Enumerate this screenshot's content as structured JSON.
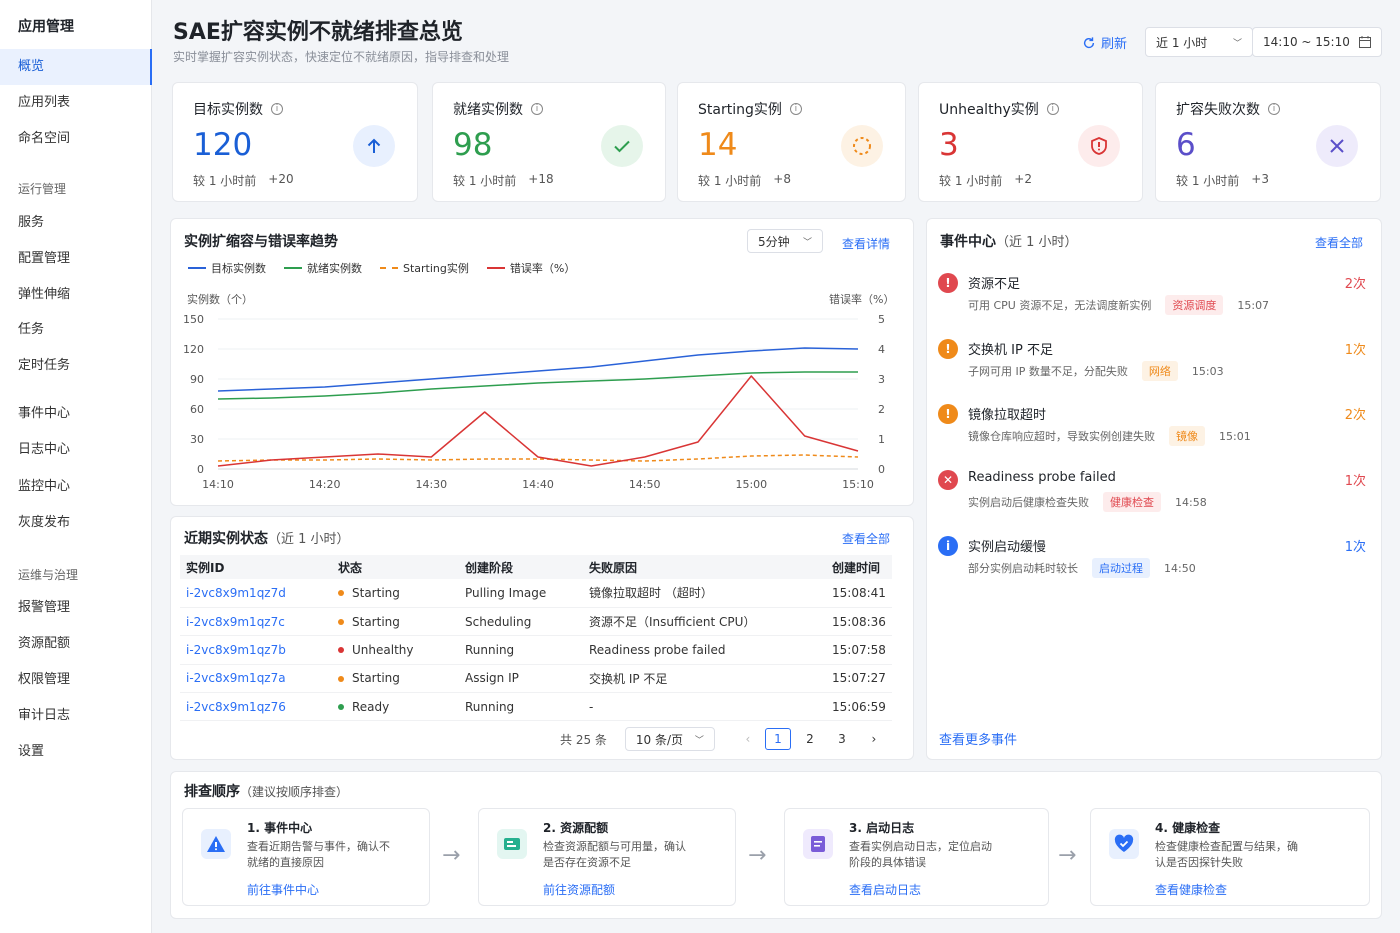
{
  "sidebar": {
    "title": "应用管理",
    "items": [
      {
        "label": "概览",
        "active": true
      },
      {
        "label": "应用列表"
      },
      {
        "label": "命名空间"
      }
    ],
    "group2": "运行管理",
    "items2": [
      {
        "label": "服务"
      },
      {
        "label": "配置管理"
      },
      {
        "label": "弹性伸缩"
      },
      {
        "label": "任务"
      },
      {
        "label": "定时任务"
      }
    ],
    "items3": [
      {
        "label": "事件中心"
      },
      {
        "label": "日志中心"
      },
      {
        "label": "监控中心"
      },
      {
        "label": "灰度发布"
      }
    ],
    "group4": "运维与治理",
    "items4": [
      {
        "label": "报警管理"
      },
      {
        "label": "资源配额"
      },
      {
        "label": "权限管理"
      },
      {
        "label": "审计日志"
      },
      {
        "label": "设置"
      }
    ]
  },
  "header": {
    "title": "SAE扩容实例不就绪排查总览",
    "subtitle": "实时掌握扩容实例状态，快速定位不就绪原因，指导排查和处理",
    "refresh": "刷新",
    "range": "近 1 小时",
    "time_span": "14:10 ~ 15:10"
  },
  "kpis": [
    {
      "label": "目标实例数",
      "value": "120",
      "prefix": "较 1 小时前",
      "delta": "+20",
      "color": "#1a5fd6",
      "icon": "arrow-up-icon"
    },
    {
      "label": "就绪实例数",
      "value": "98",
      "prefix": "较 1 小时前",
      "delta": "+18",
      "color": "#2e9e4f",
      "icon": "check-icon"
    },
    {
      "label": "Starting实例",
      "value": "14",
      "prefix": "较 1 小时前",
      "delta": "+8",
      "color": "#ef8a1a",
      "icon": "loading-icon"
    },
    {
      "label": "Unhealthy实例",
      "value": "3",
      "prefix": "较 1 小时前",
      "delta": "+2",
      "color": "#d93535",
      "icon": "shield-alert-icon"
    },
    {
      "label": "扩容失败次数",
      "value": "6",
      "prefix": "较 1 小时前",
      "delta": "+3",
      "color": "#5b4fc9",
      "icon": "close-icon"
    }
  ],
  "trend": {
    "title": "实例扩缩容与错误率趋势",
    "interval": "5分钟",
    "details": "查看详情",
    "left_axis": "实例数（个）",
    "right_axis": "错误率（%）"
  },
  "chart_data": {
    "type": "line",
    "x": [
      "14:10",
      "14:15",
      "14:20",
      "14:25",
      "14:30",
      "14:35",
      "14:40",
      "14:45",
      "14:50",
      "14:55",
      "15:00",
      "15:05",
      "15:10"
    ],
    "x_ticks": [
      "14:10",
      "14:20",
      "14:30",
      "14:40",
      "14:50",
      "15:00",
      "15:10"
    ],
    "y_left_ticks": [
      "150",
      "120",
      "90",
      "60",
      "30",
      "0"
    ],
    "y_right_ticks": [
      "5",
      "4",
      "3",
      "2",
      "1",
      "0"
    ],
    "ylim_left": [
      0,
      150
    ],
    "ylim_right": [
      0,
      5
    ],
    "series": [
      {
        "name": "目标实例数",
        "axis": "left",
        "color": "#2a62d8",
        "dash": false,
        "values": [
          78,
          80,
          82,
          86,
          90,
          94,
          98,
          102,
          108,
          114,
          118,
          121,
          120
        ]
      },
      {
        "name": "就绪实例数",
        "axis": "left",
        "color": "#2e9e4f",
        "dash": false,
        "values": [
          70,
          71,
          73,
          76,
          80,
          83,
          86,
          88,
          90,
          93,
          96,
          97,
          97
        ]
      },
      {
        "name": "Starting实例",
        "axis": "left",
        "color": "#ef8a1a",
        "dash": true,
        "values": [
          8,
          9,
          9,
          10,
          9,
          10,
          10,
          9,
          8,
          10,
          13,
          14,
          12
        ]
      },
      {
        "name": "错误率（%）",
        "axis": "right",
        "color": "#d93535",
        "dash": false,
        "values": [
          0.1,
          0.3,
          0.4,
          0.5,
          0.4,
          1.9,
          0.4,
          0.1,
          0.4,
          0.9,
          3.1,
          1.1,
          0.6
        ]
      }
    ]
  },
  "recent": {
    "title": "近期实例状态",
    "scope": "（近 1 小时）",
    "view_all": "查看全部",
    "columns": [
      "实例ID",
      "状态",
      "创建阶段",
      "失败原因",
      "创建时间"
    ],
    "rows": [
      {
        "id": "i-2vc8x9m1qz7d",
        "status": "Starting",
        "color": "#ef8a1a",
        "stage": "Pulling Image",
        "reason": "镜像拉取超时 （超时）",
        "time": "15:08:41"
      },
      {
        "id": "i-2vc8x9m1qz7c",
        "status": "Starting",
        "color": "#ef8a1a",
        "stage": "Scheduling",
        "reason": "资源不足（Insufficient CPU）",
        "time": "15:08:36"
      },
      {
        "id": "i-2vc8x9m1qz7b",
        "status": "Unhealthy",
        "color": "#d93535",
        "stage": "Running",
        "reason": "Readiness probe failed",
        "time": "15:07:58"
      },
      {
        "id": "i-2vc8x9m1qz7a",
        "status": "Starting",
        "color": "#ef8a1a",
        "stage": "Assign IP",
        "reason": "交换机 IP 不足",
        "time": "15:07:27"
      },
      {
        "id": "i-2vc8x9m1qz76",
        "status": "Ready",
        "color": "#2e9e4f",
        "stage": "Running",
        "reason": "-",
        "time": "15:06:59"
      }
    ],
    "total": "共 25 条",
    "page_size": "10 条/页",
    "pages": [
      "1",
      "2",
      "3"
    ]
  },
  "events": {
    "title": "事件中心",
    "scope": "（近 1 小时）",
    "view_all": "查看全部",
    "more": "查看更多事件",
    "items": [
      {
        "title": "资源不足",
        "desc": "可用 CPU 资源不足，无法调度新实例",
        "tag": "资源调度",
        "tag_color": "#e0484f",
        "tag_bg": "#fdecec",
        "time": "15:07",
        "count": "2次",
        "count_color": "#e0484f",
        "icon_bg": "#e0484f",
        "glyph": "!"
      },
      {
        "title": "交换机 IP 不足",
        "desc": "子网可用 IP 数量不足，分配失败",
        "tag": "网络",
        "tag_color": "#ef8a1a",
        "tag_bg": "#fdf2e4",
        "time": "15:03",
        "count": "1次",
        "count_color": "#ef8a1a",
        "icon_bg": "#ef8a1a",
        "glyph": "!"
      },
      {
        "title": "镜像拉取超时",
        "desc": "镜像仓库响应超时，导致实例创建失败",
        "tag": "镜像",
        "tag_color": "#ef8a1a",
        "tag_bg": "#fdf2e4",
        "time": "15:01",
        "count": "2次",
        "count_color": "#ef8a1a",
        "icon_bg": "#ef8a1a",
        "glyph": "!"
      },
      {
        "title": "Readiness probe failed",
        "desc": "实例启动后健康检查失败",
        "tag": "健康检查",
        "tag_color": "#e0484f",
        "tag_bg": "#fdecec",
        "time": "14:58",
        "count": "1次",
        "count_color": "#e0484f",
        "icon_bg": "#e0484f",
        "glyph": "✕"
      },
      {
        "title": "实例启动缓慢",
        "desc": "部分实例启动耗时较长",
        "tag": "启动过程",
        "tag_color": "#2a6ef5",
        "tag_bg": "#e8f0fe",
        "time": "14:50",
        "count": "1次",
        "count_color": "#2a6ef5",
        "icon_bg": "#2a6ef5",
        "glyph": "i"
      }
    ]
  },
  "steps": {
    "title": "排查顺序",
    "hint": "（建议按顺序排查）",
    "items": [
      {
        "title": "1. 事件中心",
        "desc": "查看近期告警与事件，确认不就绪的直接原因",
        "link": "前往事件中心",
        "icon": "warning-icon",
        "bg": "#e8f0fe",
        "fg": "#2a6ef5"
      },
      {
        "title": "2. 资源配额",
        "desc": "检查资源配额与可用量，确认是否存在资源不足",
        "link": "前往资源配额",
        "icon": "quota-icon",
        "bg": "#e3f6f1",
        "fg": "#25b08f"
      },
      {
        "title": "3. 启动日志",
        "desc": "查看实例启动日志，定位启动阶段的具体错误",
        "link": "查看启动日志",
        "icon": "log-icon",
        "bg": "#efeafd",
        "fg": "#7a5cd8"
      },
      {
        "title": "4. 健康检查",
        "desc": "检查健康检查配置与结果，确认是否因探针失败",
        "link": "查看健康检查",
        "icon": "heart-check-icon",
        "bg": "#e8f0fe",
        "fg": "#2a6ef5"
      }
    ]
  }
}
